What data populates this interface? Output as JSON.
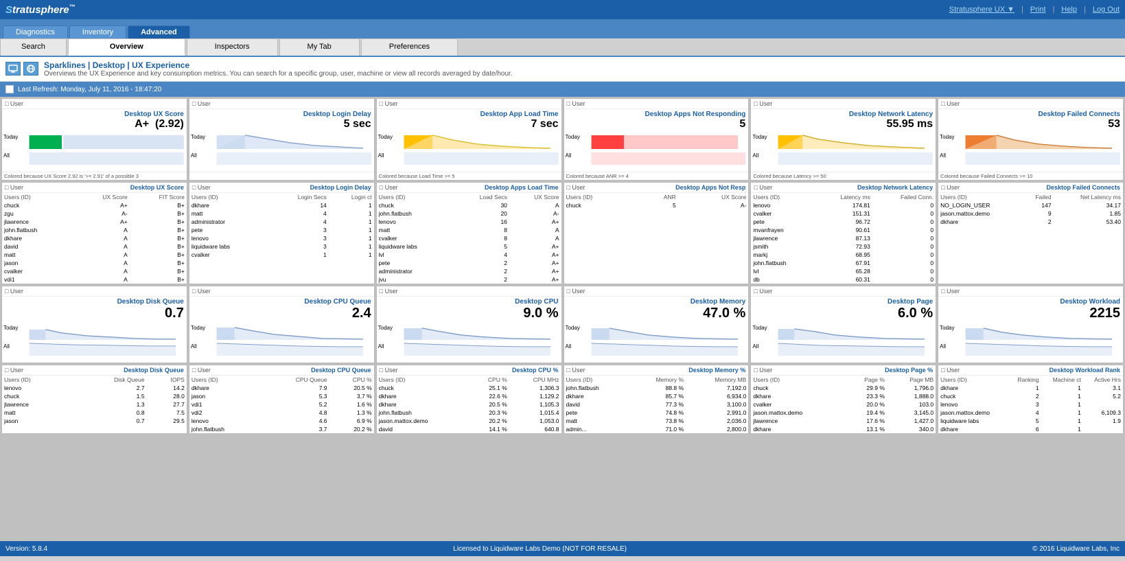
{
  "header": {
    "logo": "Stratusphere",
    "logo_tm": "™",
    "links": [
      "Stratusphere UX ▼",
      "Print",
      "Help",
      "Log Out"
    ]
  },
  "nav": {
    "tabs": [
      "Diagnostics",
      "Inventory",
      "Advanced"
    ],
    "active": "Advanced"
  },
  "content_tabs": [
    "Search",
    "Overview",
    "Inspectors",
    "My Tab",
    "Preferences"
  ],
  "active_content_tab": "Overview",
  "page": {
    "icons": [
      "monitor",
      "globe"
    ],
    "breadcrumb": "Sparklines | Desktop | UX Experience",
    "description": "Overviews the UX Experience and key consumption metrics. You can search for a specific group, user, machine or view all records averaged by date/hour."
  },
  "refresh": {
    "label": "Last Refresh: Monday, July 11, 2016 - 18:47:20"
  },
  "cards_row1": [
    {
      "type": "User",
      "metric": "Desktop UX Score",
      "value": "A+  (2.92)",
      "note": "Colored because UX Score 2.92 is '>= 2.91' of a possible 3",
      "bar_color": "green",
      "today_label": "Today",
      "all_label": "All"
    },
    {
      "type": "User",
      "metric": "Desktop Login Delay",
      "value": "5 sec",
      "note": "",
      "bar_color": "blue",
      "today_label": "Today",
      "all_label": "All"
    },
    {
      "type": "User",
      "metric": "Desktop App Load Time",
      "value": "7 sec",
      "note": "Colored because Load Time >= 5",
      "bar_color": "yellow",
      "today_label": "Today",
      "all_label": "All"
    },
    {
      "type": "User",
      "metric": "Desktop Apps Not Responding",
      "value": "5",
      "note": "Colored because ANR >= 4",
      "bar_color": "red",
      "today_label": "Today",
      "all_label": "All"
    },
    {
      "type": "User",
      "metric": "Desktop Network Latency",
      "value": "55.95 ms",
      "note": "Colored because Latency >= 50",
      "bar_color": "yellow",
      "today_label": "Today",
      "all_label": "All"
    },
    {
      "type": "User",
      "metric": "Desktop Failed Connects",
      "value": "53",
      "note": "Colored because Failed Connects >= 10",
      "bar_color": "orange",
      "today_label": "Today",
      "all_label": "All"
    }
  ],
  "cards_row2": [
    {
      "type": "User",
      "metric": "Desktop UX Score",
      "columns": [
        "Users (ID)",
        "UX Score",
        "FIT Score"
      ],
      "rows": [
        [
          "chuck",
          "A+",
          "B+"
        ],
        [
          "zgu",
          "A-",
          "B+"
        ],
        [
          "jlawrence",
          "A+",
          "B+"
        ],
        [
          "john.flatbush",
          "A",
          "B+"
        ],
        [
          "dkhare",
          "A",
          "B+"
        ],
        [
          "david",
          "A",
          "B+"
        ],
        [
          "matt",
          "A",
          "B+"
        ],
        [
          "jason",
          "A",
          "B+"
        ],
        [
          "cvalker",
          "A",
          "B+"
        ],
        [
          "vdi1",
          "A",
          "B+"
        ]
      ]
    },
    {
      "type": "User",
      "metric": "Desktop Login Delay",
      "columns": [
        "Users (ID)",
        "Login Secs",
        "Login ct"
      ],
      "rows": [
        [
          "dkhare",
          "14",
          "1"
        ],
        [
          "matt",
          "4",
          "1"
        ],
        [
          "administrator",
          "4",
          "1"
        ],
        [
          "pete",
          "3",
          "1"
        ],
        [
          "lenovo",
          "3",
          "1"
        ],
        [
          "liquidware labs",
          "3",
          "1"
        ],
        [
          "cvalker",
          "1",
          "1"
        ]
      ]
    },
    {
      "type": "User",
      "metric": "Desktop Apps Load Time",
      "columns": [
        "Users (ID)",
        "Load Secs",
        "UX Score"
      ],
      "rows": [
        [
          "chuck",
          "30",
          "A"
        ],
        [
          "john.flatbush",
          "20",
          "A-"
        ],
        [
          "lenovo",
          "16",
          "A+"
        ],
        [
          "matt",
          "8",
          "A"
        ],
        [
          "cvalker",
          "8",
          "A"
        ],
        [
          "liquidware labs",
          "5",
          "A+"
        ],
        [
          "lvl",
          "4",
          "A+"
        ],
        [
          "pete",
          "2",
          "A+"
        ],
        [
          "administrator",
          "2",
          "A+"
        ],
        [
          "jvu",
          "2",
          "A+"
        ]
      ]
    },
    {
      "type": "User",
      "metric": "Desktop Apps Not Resp",
      "columns": [
        "Users (ID)",
        "ANR",
        "UX Score"
      ],
      "rows": [
        [
          "chuck",
          "5",
          "A-"
        ]
      ]
    },
    {
      "type": "User",
      "metric": "Desktop Network Latency",
      "columns": [
        "Users (ID)",
        "Latency ms",
        "Failed Conn."
      ],
      "rows": [
        [
          "lenovo",
          "174.81",
          "0"
        ],
        [
          "cvalker",
          "151.31",
          "0"
        ],
        [
          "pete",
          "96.72",
          "0"
        ],
        [
          "mvanfrayen",
          "90.61",
          "0"
        ],
        [
          "jlawrence",
          "87.13",
          "0"
        ],
        [
          "jsmith",
          "72.93",
          "0"
        ],
        [
          "markj",
          "68.95",
          "0"
        ],
        [
          "john.flatbush",
          "67.91",
          "0"
        ],
        [
          "lvl",
          "65.28",
          "0"
        ],
        [
          "db",
          "60.31",
          "0"
        ]
      ]
    },
    {
      "type": "User",
      "metric": "Desktop Failed Connects",
      "columns": [
        "Users (ID)",
        "Failed",
        "Net Latency ms"
      ],
      "rows": [
        [
          "NO_LOGIN_USER",
          "147",
          "34.17"
        ],
        [
          "jason.mattox.demo",
          "9",
          "1.85"
        ],
        [
          "dkhare",
          "2",
          "53.40"
        ]
      ]
    }
  ],
  "cards_row3": [
    {
      "type": "User",
      "metric": "Desktop Disk Queue",
      "value": "0.7",
      "today_label": "Today",
      "all_label": "All"
    },
    {
      "type": "User",
      "metric": "Desktop CPU Queue",
      "value": "2.4",
      "today_label": "Today",
      "all_label": "All"
    },
    {
      "type": "User",
      "metric": "Desktop CPU",
      "value": "9.0 %",
      "today_label": "Today",
      "all_label": "All"
    },
    {
      "type": "User",
      "metric": "Desktop Memory",
      "value": "47.0 %",
      "today_label": "Today",
      "all_label": "All"
    },
    {
      "type": "User",
      "metric": "Desktop Page",
      "value": "6.0 %",
      "today_label": "Today",
      "all_label": "All"
    },
    {
      "type": "User",
      "metric": "Desktop Workload",
      "value": "2215",
      "today_label": "Today",
      "all_label": "All"
    }
  ],
  "cards_row4": [
    {
      "type": "User",
      "metric": "Desktop Disk Queue",
      "columns": [
        "Users (ID)",
        "Disk Queue",
        "IOPS"
      ],
      "rows": [
        [
          "lenovo",
          "2.7",
          "14.2"
        ],
        [
          "chuck",
          "1.5",
          "28.0"
        ],
        [
          "jlawrence",
          "1.3",
          "27.7"
        ],
        [
          "matt",
          "0.8",
          "7.5"
        ],
        [
          "jason",
          "0.7",
          "29.5"
        ]
      ]
    },
    {
      "type": "User",
      "metric": "Desktop CPU Queue",
      "columns": [
        "Users (ID)",
        "CPU Queue",
        "CPU %"
      ],
      "rows": [
        [
          "dkhare",
          "7.9",
          "20.5 %"
        ],
        [
          "jason",
          "5.3",
          "3.7 %"
        ],
        [
          "vdi1",
          "5.2",
          "1.6 %"
        ],
        [
          "vdi2",
          "4.8",
          "1.3 %"
        ],
        [
          "lenovo",
          "4.6",
          "6.9 %"
        ]
      ]
    },
    {
      "type": "User",
      "metric": "Desktop CPU %",
      "columns": [
        "Users (ID)",
        "CPU %",
        "CPU MHz"
      ],
      "rows": [
        [
          "chuck",
          "25.1 %",
          "1,306.3"
        ],
        [
          "dkhare",
          "22.6 %",
          "1,129.2"
        ],
        [
          "dkhare",
          "20.5 %",
          "1,105.3"
        ],
        [
          "john.flatbush",
          "20.3 %",
          "1,015.4"
        ],
        [
          "jason.mattox.demo",
          "20.2 %",
          "1,053.0"
        ]
      ]
    },
    {
      "type": "User",
      "metric": "Desktop Memory %",
      "columns": [
        "Users (ID)",
        "Memory %",
        "Memory MB"
      ],
      "rows": [
        [
          "john.flatbush",
          "88.8 %",
          "7,192.0"
        ],
        [
          "dkhare",
          "85.7 %",
          "6,934.0"
        ],
        [
          "david",
          "77.3 %",
          "3,100.0"
        ],
        [
          "pete",
          "74.8 %",
          "2,991.0"
        ],
        [
          "matt",
          "73.8 %",
          "2,036.0"
        ]
      ]
    },
    {
      "type": "User",
      "metric": "Desktop Page %",
      "columns": [
        "Users (ID)",
        "Page %",
        "Page MB"
      ],
      "rows": [
        [
          "chuck",
          "29.9 %",
          "1,796.0"
        ],
        [
          "dkhare",
          "23.3 %",
          "1,888.0"
        ],
        [
          "cvalker",
          "20.0 %",
          "103.0"
        ],
        [
          "jason.mattox.demo",
          "19.4 %",
          "3,145.0"
        ],
        [
          "jlawrence",
          "17.6 %",
          "1,427.0"
        ]
      ]
    },
    {
      "type": "User",
      "metric": "Desktop Workload Rank",
      "columns": [
        "Users (ID)",
        "Ranking",
        "Machine ct",
        "Active Hrs"
      ],
      "rows": [
        [
          "dkhare",
          "1",
          "1",
          "3.1"
        ],
        [
          "chuck",
          "2",
          "1",
          "5.2"
        ],
        [
          "lenovo",
          "3",
          "1",
          ""
        ],
        [
          "jason.mattox.demo",
          "4",
          "1",
          "6,109.3"
        ],
        [
          "liquidware labs",
          "5",
          "1",
          "1.9"
        ]
      ]
    }
  ],
  "status_bar": {
    "left": "Version: 5.8.4",
    "center": "Licensed to Liquidware Labs Demo (NOT FOR RESALE)",
    "right": "© 2016 Liquidware Labs, Inc"
  }
}
